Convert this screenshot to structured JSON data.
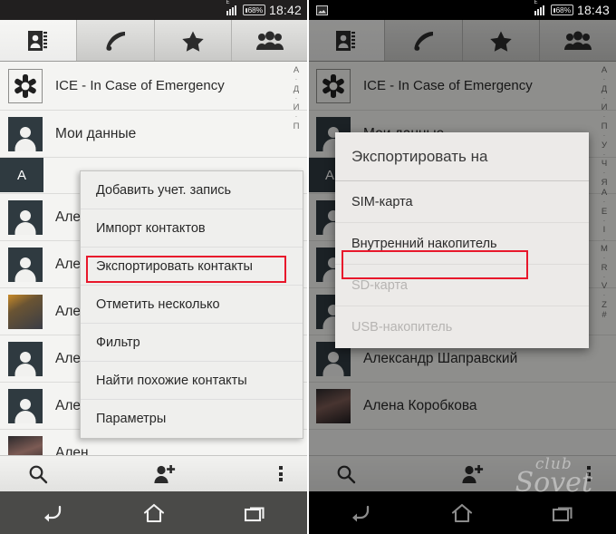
{
  "left_phone": {
    "statusbar": {
      "signal_type": "E",
      "battery": "68%",
      "time": "18:42"
    },
    "tabs": [
      {
        "name": "contacts",
        "icon": "contacts-book-icon",
        "active": true
      },
      {
        "name": "dialer",
        "icon": "phone-handset-icon",
        "active": false
      },
      {
        "name": "favorites",
        "icon": "star-icon",
        "active": false
      },
      {
        "name": "groups",
        "icon": "people-group-icon",
        "active": false
      }
    ],
    "contacts": [
      {
        "name": "ICE - In Case of Emergency",
        "avatar": "ice-star-icon"
      },
      {
        "name": "Мои данные",
        "avatar": "default-person"
      },
      {
        "name": "Алек",
        "avatar": "default-person"
      },
      {
        "name": "Алек",
        "avatar": "default-person"
      },
      {
        "name": "Алек",
        "avatar": "photo"
      },
      {
        "name": "Алек",
        "avatar": "default-person"
      },
      {
        "name": "Алек",
        "avatar": "default-person"
      },
      {
        "name": "Ален",
        "avatar": "photo"
      }
    ],
    "section_header": "A",
    "alphabet_index": [
      "А",
      "·",
      "Д",
      "·",
      "И",
      "·",
      "П"
    ],
    "menu": {
      "items": [
        "Добавить учет. запись",
        "Импорт контактов",
        "Экспортировать контакты",
        "Отметить несколько",
        "Фильтр",
        "Найти похожие контакты",
        "Параметры"
      ],
      "highlighted_item": "Экспортировать контакты",
      "highlight_color": "#e8172b"
    },
    "actionbar": [
      {
        "name": "search",
        "icon": "search-icon"
      },
      {
        "name": "add-contact",
        "icon": "add-person-icon"
      },
      {
        "name": "overflow",
        "icon": "overflow-menu-icon"
      }
    ],
    "navbar": [
      {
        "name": "back",
        "icon": "back-arrow-icon"
      },
      {
        "name": "home",
        "icon": "home-icon"
      },
      {
        "name": "recents",
        "icon": "recents-icon"
      }
    ]
  },
  "right_phone": {
    "statusbar": {
      "notification_icon": "screenshot-image-icon",
      "signal_type": "E",
      "battery": "68%",
      "time": "18:43"
    },
    "tabs": [
      {
        "name": "contacts",
        "icon": "contacts-book-icon",
        "active": true
      },
      {
        "name": "dialer",
        "icon": "phone-handset-icon",
        "active": false
      },
      {
        "name": "favorites",
        "icon": "star-icon",
        "active": false
      },
      {
        "name": "groups",
        "icon": "people-group-icon",
        "active": false
      }
    ],
    "contacts": [
      {
        "name": "ICE - In Case of Emergency",
        "avatar": "ice-star-icon"
      },
      {
        "name": "Мои данные",
        "avatar": "default-person"
      },
      {
        "name": "Александр Шаправский",
        "avatar": "default-person"
      },
      {
        "name": "Алена Коробкова",
        "avatar": "photo"
      }
    ],
    "alphabet_index": [
      "А",
      "·",
      "Д",
      "·",
      "И",
      "·",
      "П",
      "·",
      "У",
      "·",
      "Ч",
      "·",
      "Я",
      "A",
      "·",
      "E",
      "·",
      "I",
      "·",
      "M",
      "·",
      "R",
      "·",
      "V",
      "·",
      "Z",
      "#"
    ],
    "dialog": {
      "title": "Экспортировать на",
      "items": [
        {
          "label": "SIM-карта",
          "enabled": true
        },
        {
          "label": "Внутренний накопитель",
          "enabled": true
        },
        {
          "label": "SD-карта",
          "enabled": false
        },
        {
          "label": "USB-накопитель",
          "enabled": false
        }
      ],
      "highlighted_item": "Внутренний накопитель",
      "highlight_color": "#e8172b"
    },
    "actionbar": [
      {
        "name": "search",
        "icon": "search-icon"
      },
      {
        "name": "add-contact",
        "icon": "add-person-icon"
      },
      {
        "name": "overflow",
        "icon": "overflow-menu-icon"
      }
    ],
    "navbar": [
      {
        "name": "back",
        "icon": "back-arrow-icon"
      },
      {
        "name": "home",
        "icon": "home-icon"
      },
      {
        "name": "recents",
        "icon": "recents-icon"
      }
    ],
    "watermark": {
      "line1": "club",
      "line2": "Sovet"
    }
  }
}
